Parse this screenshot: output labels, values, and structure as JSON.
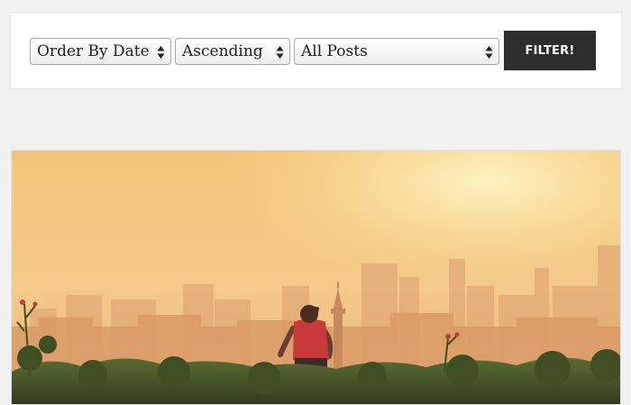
{
  "filters": {
    "order_by": {
      "selected": "Order By Date"
    },
    "direction": {
      "selected": "Ascending"
    },
    "post_type": {
      "selected": "All Posts"
    },
    "submit_label": "FILTER!"
  },
  "featured_image": {
    "subject": "runner-silhouette-city-sunrise-photo",
    "colors": {
      "sky_top": "#f6cf7e",
      "sky_glow": "#fff0b8",
      "haze": "#e8b77a",
      "foliage": "#3f4f22",
      "shirt": "#c83a3a"
    }
  }
}
